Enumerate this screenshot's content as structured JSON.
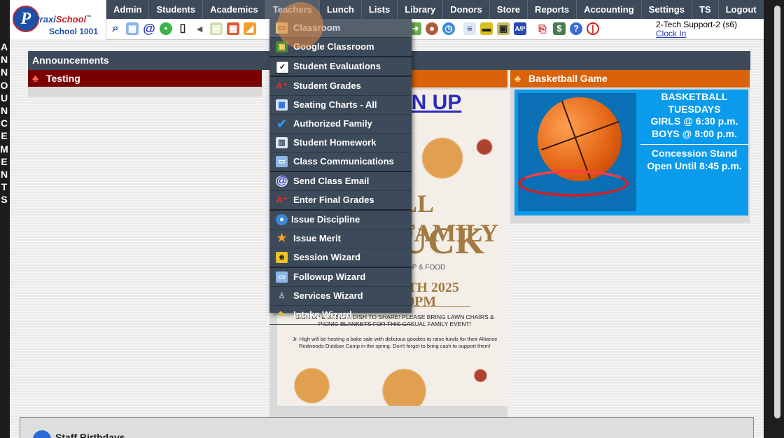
{
  "side_vertical_text": "ANNOUNCEMENTS",
  "logo": {
    "brand_left": "Praxi",
    "brand_right": "School",
    "tm": "™",
    "school": "School 1001"
  },
  "nav": {
    "items": [
      "Admin",
      "Students",
      "Academics",
      "Teachers",
      "Lunch",
      "Lists",
      "Library",
      "Donors",
      "Store",
      "Reports",
      "Accounting",
      "Settings",
      "TS",
      "Logout"
    ],
    "active": "Teachers"
  },
  "toolbar_icons": [
    "search-icon",
    "calendar-grid-icon",
    "email-at-icon",
    "chat-icon",
    "phone-icon",
    "speaker-icon",
    "grid-icon",
    "calendar-icon",
    "megaphone-icon",
    "export-icon",
    "users-icon",
    "clock-icon",
    "document-icon",
    "ticket-icon",
    "printer-icon",
    "ap-icon",
    "pdf-icon",
    "money-icon",
    "help-icon",
    "power-icon"
  ],
  "user": {
    "name": "2-Tech Support-2 (s6)",
    "clock_link": "Clock In"
  },
  "announcements": {
    "header": "Announcements"
  },
  "panels": {
    "testing": {
      "title": "Testing"
    },
    "potluck": {
      "title": "ck",
      "signup": "IGN UP",
      "poster_line1": "LL FAMILY",
      "poster_line2": "UCK",
      "poster_sub": "SHIP & FOOD",
      "poster_date": "0TH 2025",
      "poster_time": "30PM",
      "poster_note1": "SIGN UP & BRING A DISH TO SHARE! PLEASE BRING LAWN CHAIRS & PICNIC BLANKETS FOR THIS CASUAL FAMILY EVENT!",
      "poster_note2": "Jr. High will be hosting a bake sale with delicious goodies to raise funds for their Alliance Redwoods Outdoor Camp in the spring. Don't forget to bring cash to support them!"
    },
    "basketball": {
      "title": "Basketball Game",
      "line1": "BASKETBALL",
      "line2": "TUESDAYS",
      "line3": "GIRLS @ 6:30 p.m.",
      "line4": "BOYS  @ 8:00 p.m.",
      "line5": "Concession Stand",
      "line6": "Open Until 8:45 p.m."
    }
  },
  "staff_birthdays": {
    "title": "Staff Birthdays"
  },
  "teachers_menu": [
    {
      "label": "Classroom",
      "icon": "classroom-icon"
    },
    {
      "label": "Google Classroom",
      "icon": "google-classroom-icon"
    },
    {
      "label": "Student Evaluations",
      "icon": "checkbox-icon"
    },
    {
      "label": "Student Grades",
      "icon": "grade-a-plus-icon"
    },
    {
      "label": "Seating Charts - All",
      "icon": "seating-chart-icon"
    },
    {
      "label": "Authorized Family",
      "icon": "checkmark-icon"
    },
    {
      "label": "Student Homework",
      "icon": "book-icon"
    },
    {
      "label": "Class Communications",
      "icon": "communications-icon"
    },
    {
      "label": "Send Class Email",
      "icon": "email-at-icon"
    },
    {
      "label": "Enter Final Grades",
      "icon": "grade-a-plus-icon"
    },
    {
      "label": "Issue Discipline",
      "icon": "discipline-icon"
    },
    {
      "label": "Issue Merit",
      "icon": "star-icon"
    },
    {
      "label": "Session Wizard",
      "icon": "session-icon"
    },
    {
      "label": "Followup Wizard",
      "icon": "followup-icon"
    },
    {
      "label": "Services Wizard",
      "icon": "services-icon"
    },
    {
      "label": "Intake Wizard",
      "icon": "intake-icon"
    }
  ]
}
